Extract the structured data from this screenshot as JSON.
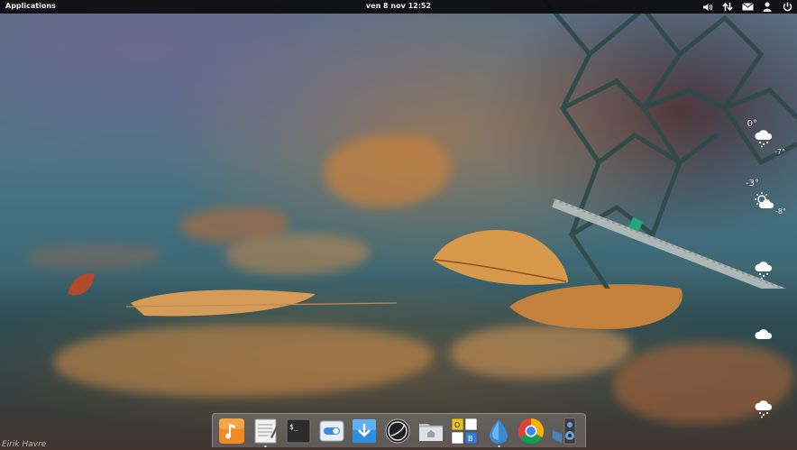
{
  "top_panel": {
    "applications_label": "Applications",
    "clock": "ven  8 nov 12:52",
    "indicators": [
      {
        "name": "volume-icon"
      },
      {
        "name": "network-icon"
      },
      {
        "name": "mail-icon"
      },
      {
        "name": "user-icon"
      },
      {
        "name": "power-icon"
      }
    ]
  },
  "weather": {
    "days": [
      {
        "high": "0°",
        "low": "-7°",
        "icon": "snow-cloud-icon"
      },
      {
        "high": "-3°",
        "low": "-8°",
        "icon": "sun-cloud-icon"
      },
      {
        "high": "",
        "low": "",
        "icon": "snow-cloud-icon"
      },
      {
        "high": "",
        "low": "",
        "icon": "cloud-icon"
      },
      {
        "high": "",
        "low": "",
        "icon": "snow-cloud-icon"
      }
    ]
  },
  "dock": {
    "items": [
      {
        "name": "music-player-icon",
        "color": "#f08a24"
      },
      {
        "name": "text-editor-icon",
        "color": "#e8e8e8"
      },
      {
        "name": "terminal-icon",
        "color": "#2b2b2b",
        "glyph": "$_"
      },
      {
        "name": "settings-switch-icon",
        "color": "#3b8de0"
      },
      {
        "name": "download-manager-icon",
        "color": "#2e8fe0"
      },
      {
        "name": "elementary-icon",
        "color": "#1e1e1e"
      },
      {
        "name": "file-manager-icon",
        "color": "#cfd3d8"
      },
      {
        "name": "office-icon",
        "color": "#e8c022"
      },
      {
        "name": "water-drop-icon",
        "color": "#3a8ad4"
      },
      {
        "name": "chrome-icon",
        "color": "#db4437"
      },
      {
        "name": "audio-speaker-icon",
        "color": "#4a7fb8"
      }
    ],
    "running": [
      "text-editor-icon",
      "water-drop-icon"
    ]
  },
  "credit": "Eirik Havre"
}
